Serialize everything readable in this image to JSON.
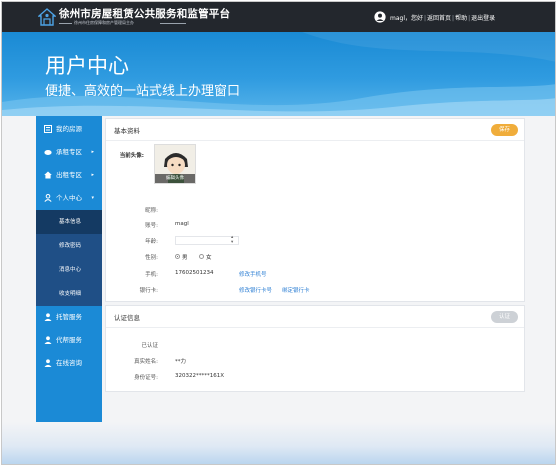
{
  "header": {
    "site_title": "徐州市房屋租赁公共服务和监管平台",
    "site_subtitle": "徐州市住房保障和房产管理局主办",
    "greeting": "magl，您好",
    "links": [
      "返回首页",
      "帮助",
      "退出登录"
    ]
  },
  "banner": {
    "title": "用户中心",
    "subtitle": "便捷、高效的一站式线上办理窗口"
  },
  "sidebar": {
    "items": [
      {
        "label": "我的房源",
        "icon": "house-list-icon",
        "arrow": ""
      },
      {
        "label": "承租专区",
        "icon": "handshake-icon",
        "arrow": "▸"
      },
      {
        "label": "出租专区",
        "icon": "home-icon",
        "arrow": "▸"
      },
      {
        "label": "个人中心",
        "icon": "person-icon",
        "arrow": "▾"
      }
    ],
    "subitems": [
      {
        "label": "基本信息",
        "active": true
      },
      {
        "label": "修改密码",
        "active": false
      },
      {
        "label": "消息中心",
        "active": false
      },
      {
        "label": "收支明细",
        "active": false
      }
    ],
    "items2": [
      {
        "label": "托管服务",
        "icon": "user-service-icon"
      },
      {
        "label": "代帮服务",
        "icon": "helper-icon"
      },
      {
        "label": "在线咨询",
        "icon": "chat-icon"
      }
    ]
  },
  "basic": {
    "title": "基本资料",
    "save_label": "保存",
    "avatar_label": "当前头像:",
    "avatar_caption": "编辑头像",
    "nickname_label": "昵称:",
    "nickname_value": "",
    "account_label": "账号:",
    "account_value": "magl",
    "age_label": "年龄:",
    "age_value": "",
    "gender_label": "性别:",
    "gender_male": "男",
    "gender_female": "女",
    "gender_selected": "男",
    "phone_label": "手机:",
    "phone_value": "17602501234",
    "phone_link": "修改手机号",
    "bank_label": "银行卡:",
    "bank_value": "",
    "bank_link1": "修改银行卡号",
    "bank_link2": "绑定银行卡"
  },
  "auth": {
    "title": "认证信息",
    "button_label": "认证",
    "status": "已认证",
    "name_label": "真实姓名:",
    "name_value": "**力",
    "id_label": "身份证号:",
    "id_value": "320322*****161X"
  },
  "colors": {
    "header_bg": "#23272d",
    "banner_blue": "#1a8ad4",
    "sidebar_blue": "#1b8ad6",
    "submenu_navy": "#1f4f86",
    "accent_orange": "#f0ad3b",
    "link_blue": "#2d7fd4"
  }
}
